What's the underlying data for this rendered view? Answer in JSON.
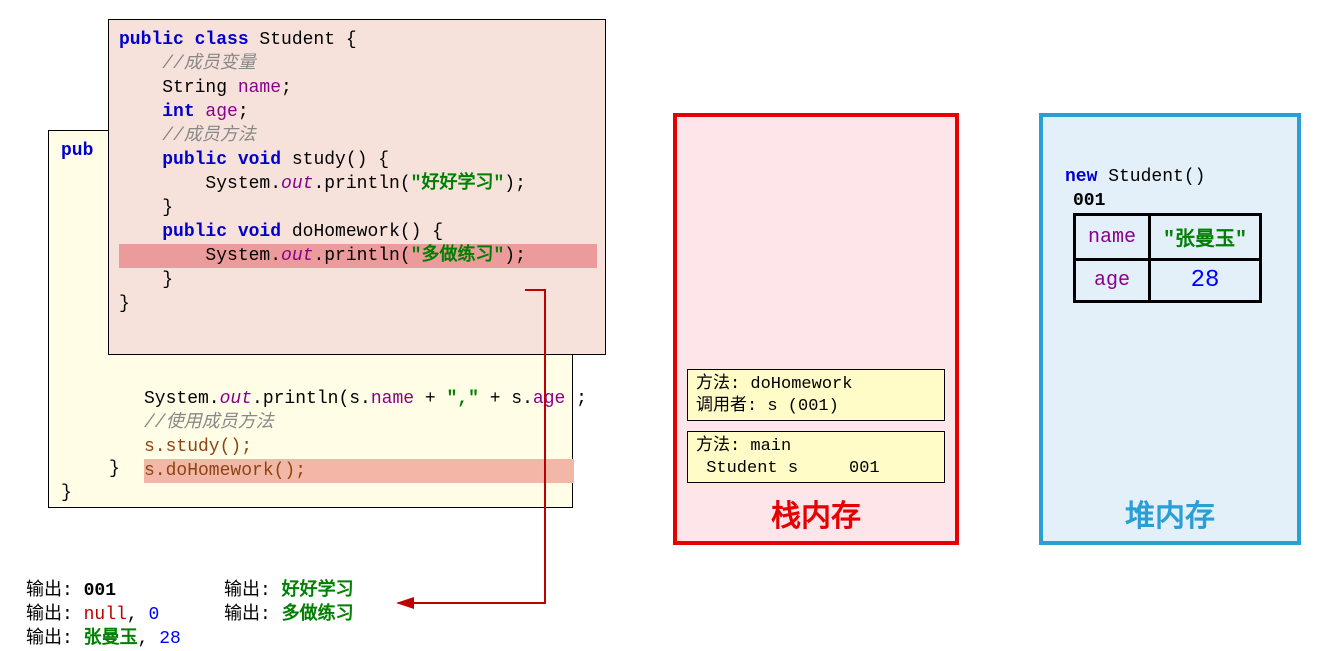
{
  "student_class": {
    "line1_kw1": "public class",
    "line1_name": " Student {",
    "comment1": "    //成员变量",
    "line3_pre": "    String ",
    "line3_name": "name",
    "line3_post": ";",
    "line4_pre": "    ",
    "line4_kw": "int",
    "line4_name": " age",
    "line4_post": ";",
    "comment2": "    //成员方法",
    "line6_pre": "    ",
    "line6_kw": "public void",
    "line6_post": " study() {",
    "line7_pre": "        System.",
    "line7_out": "out",
    "line7_mid": ".println(",
    "line7_str": "\"好好学习\"",
    "line7_post": ");",
    "line8": "    }",
    "line9_pre": "    ",
    "line9_kw": "public void",
    "line9_post": " doHomework() {",
    "line10_pre": "        System.",
    "line10_out": "out",
    "line10_mid": ".println(",
    "line10_str": "\"多做练习\"",
    "line10_post": ");",
    "line11": "    }",
    "line12": "}"
  },
  "demo_code": {
    "pub": "pub",
    "l1_pre": "System.",
    "l1_out": "out",
    "l1_mid": ".println(s.",
    "l1_n1": "name",
    "l1_plus": " + ",
    "l1_str": "\",\"",
    "l1_plus2": " + s.",
    "l1_n2": "age",
    "l1_end": " ;",
    "l2": "//使用成员方法",
    "l3": "s.study();",
    "l4": "s.doHomework();",
    "b1": "}",
    "b2": "}"
  },
  "stack": {
    "title": "栈内存",
    "frame1_l1": "方法: doHomework",
    "frame1_l2": "调用者: s (001)",
    "frame2_l1": "方法: main",
    "frame2_l2": " Student s     001"
  },
  "heap": {
    "title": "堆内存",
    "new_kw": "new",
    "new_post": " Student()",
    "addr": "001",
    "name_label": "name",
    "name_value": "\"张曼玉\"",
    "age_label": "age",
    "age_value": "28"
  },
  "output": {
    "p1": "输出: ",
    "v1": "001",
    "p2": "输出: ",
    "v2a": "null",
    "v2b": ", ",
    "v2c": "0",
    "p3": "输出: ",
    "v3a": "张曼玉",
    "v3b": ", ",
    "v3c": "28",
    "p4": "输出: ",
    "v4": "好好学习",
    "p5": "输出: ",
    "v5": "多做练习"
  }
}
